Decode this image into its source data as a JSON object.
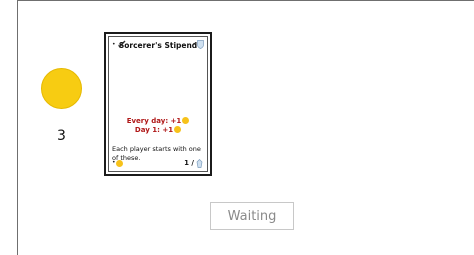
{
  "player": {
    "coin_count": "3",
    "coin_color": "#f7cc12"
  },
  "card": {
    "title": "Sorcerer's Stipend",
    "effect_line_1": "Every day: +1",
    "effect_line_2": "Day 1: +1",
    "description": "Each player starts with one of these.",
    "supply": "1 /",
    "effect_color": "#b01818",
    "icons": [
      "sword-icon",
      "shield-icon",
      "coin-icon",
      "supply-icon"
    ]
  },
  "status": {
    "waiting_label": "Waiting"
  }
}
